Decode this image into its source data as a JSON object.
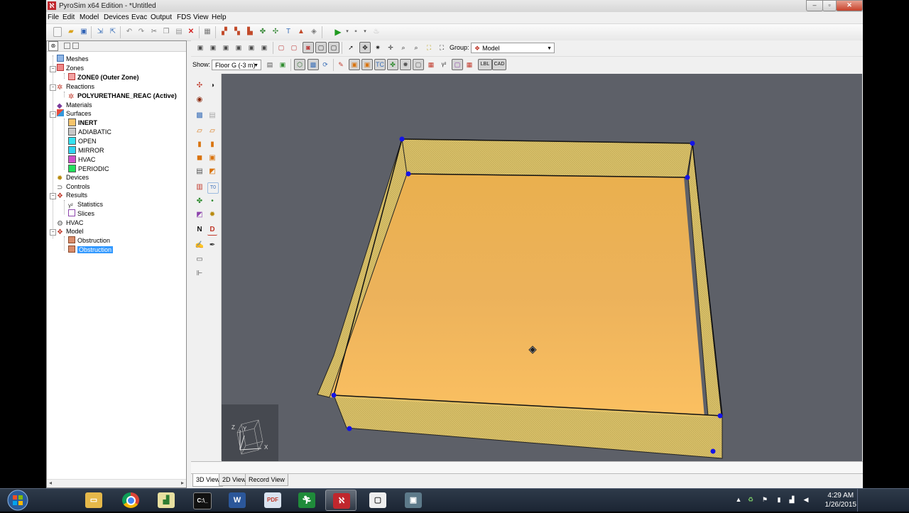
{
  "window": {
    "title": "PyroSim x64 Edition - *Untitled"
  },
  "menu": [
    "File",
    "Edit",
    "Model",
    "Devices",
    "Evac",
    "Output",
    "FDS",
    "View",
    "Help"
  ],
  "tree": {
    "meshes": "Meshes",
    "zones": "Zones",
    "zone0": "ZONE0 (Outer Zone)",
    "reactions": "Reactions",
    "reaction_active": "POLYURETHANE_REAC (Active)",
    "materials": "Materials",
    "surfaces": "Surfaces",
    "surface_items": [
      {
        "label": "INERT",
        "color": "#f5c46b"
      },
      {
        "label": "ADIABATIC",
        "color": "#c8c8c8"
      },
      {
        "label": "OPEN",
        "color": "#34e2f0"
      },
      {
        "label": "MIRROR",
        "color": "#2fd4f0"
      },
      {
        "label": "HVAC",
        "color": "#d04ecb"
      },
      {
        "label": "PERIODIC",
        "color": "#22e05c"
      }
    ],
    "devices": "Devices",
    "controls": "Controls",
    "results": "Results",
    "statistics": "Statistics",
    "slices": "Slices",
    "hvac": "HVAC",
    "model": "Model",
    "obstruction1": "Obstruction",
    "obstruction2": "Obstruction"
  },
  "view_toolbar": {
    "group_label": "Group:",
    "group_value": "Model",
    "show_label": "Show:",
    "show_value": "Floor G (-3 m)",
    "lbl_button": "LBL",
    "cad_button": "CAD"
  },
  "axis": {
    "x": "X",
    "y": "Y",
    "z": "Z"
  },
  "tabs": [
    "3D View",
    "2D View",
    "Record View"
  ],
  "active_tab": "3D View",
  "clock": {
    "time": "4:29 AM",
    "date": "1/26/2015"
  },
  "taskbar_apps": [
    "windows-explorer",
    "chrome",
    "stats-app",
    "command-prompt",
    "word",
    "pdf-reader",
    "evac-app",
    "pyrosim",
    "video-app",
    "display-app"
  ],
  "colors": {
    "viewport_bg": "#5d6068",
    "floor": "#eab04e",
    "wall": "#d9c06a",
    "vertex": "#1414e6",
    "selection": "#3399ff"
  }
}
